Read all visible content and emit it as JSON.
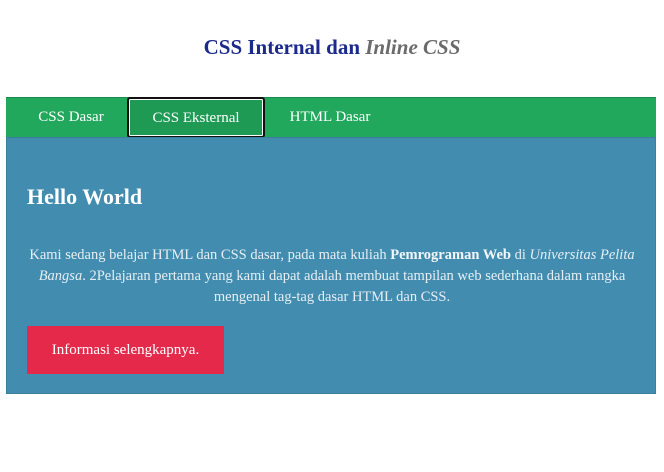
{
  "header": {
    "title_main": "CSS Internal dan ",
    "title_italic": "Inline CSS"
  },
  "nav": {
    "items": [
      {
        "label": "CSS Dasar"
      },
      {
        "label": "CSS Eksternal"
      },
      {
        "label": "HTML Dasar"
      }
    ]
  },
  "content": {
    "heading": "Hello World",
    "para_part1": "Kami sedang belajar HTML dan CSS dasar, pada mata kuliah ",
    "para_bold": "Pemrograman Web",
    "para_part2": " di ",
    "para_italic": "Universitas Pelita Bangsa",
    "para_part3": ". 2Pelajaran pertama yang kami dapat adalah membuat tampilan web sederhana dalam rangka mengenal tag-tag dasar HTML dan CSS.",
    "button_label": "Informasi selengkapnya."
  },
  "colors": {
    "title": "#1c2a8c",
    "nav_bg": "#22a85c",
    "content_bg": "#428daf",
    "button_bg": "#e4294b"
  }
}
